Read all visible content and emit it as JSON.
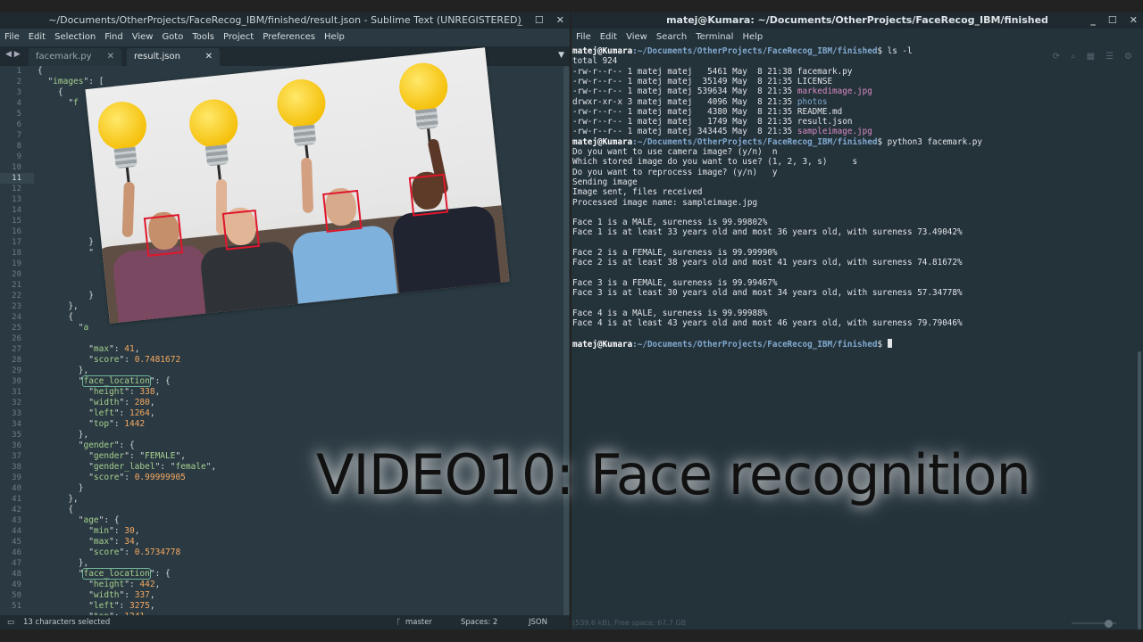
{
  "sublime": {
    "title": "~/Documents/OtherProjects/FaceRecog_IBM/finished/result.json - Sublime Text (UNREGISTERED)",
    "menu": [
      "File",
      "Edit",
      "Selection",
      "Find",
      "View",
      "Goto",
      "Tools",
      "Project",
      "Preferences",
      "Help"
    ],
    "tabs": [
      {
        "label": "facemark.py",
        "active": false
      },
      {
        "label": "result.json",
        "active": true
      }
    ],
    "current_line": 11,
    "line_numbers": [
      1,
      2,
      3,
      4,
      5,
      6,
      7,
      8,
      9,
      10,
      11,
      12,
      13,
      14,
      15,
      16,
      17,
      18,
      19,
      20,
      21,
      22,
      23,
      24,
      25,
      26,
      27,
      28,
      29,
      30,
      31,
      32,
      33,
      34,
      35,
      36,
      37,
      38,
      39,
      40,
      41,
      42,
      43,
      44,
      45,
      46,
      47,
      48,
      49,
      50,
      51
    ],
    "status": {
      "selection": "13 characters selected",
      "branch": "master",
      "spaces": "Spaces: 2",
      "syntax": "JSON"
    }
  },
  "terminal": {
    "title": "matej@Kumara: ~/Documents/OtherProjects/FaceRecog_IBM/finished",
    "menu": [
      "File",
      "Edit",
      "View",
      "Search",
      "Terminal",
      "Help"
    ],
    "prompt_user": "matej@Kumara",
    "prompt_path": ":~/Documents/OtherProjects/FaceRecog_IBM/finished",
    "commands": [
      "ls -l",
      "python3 facemark.py"
    ],
    "ls_total": "total 924",
    "ls_entries": [
      {
        "perms": "-rw-r--r-- 1 matej matej   5461 May  8 21:38 ",
        "name": "facemark.py",
        "color": "plain"
      },
      {
        "perms": "-rw-r--r-- 1 matej matej  35149 May  8 21:35 ",
        "name": "LICENSE",
        "color": "plain"
      },
      {
        "perms": "-rw-r--r-- 1 matej matej 539634 May  8 21:35 ",
        "name": "markedimage.jpg",
        "color": "pink"
      },
      {
        "perms": "drwxr-xr-x 3 matej matej   4096 May  8 21:35 ",
        "name": "photos",
        "color": "blue"
      },
      {
        "perms": "-rw-r--r-- 1 matej matej   4380 May  8 21:35 ",
        "name": "README.md",
        "color": "plain"
      },
      {
        "perms": "-rw-r--r-- 1 matej matej   1749 May  8 21:35 ",
        "name": "result.json",
        "color": "plain"
      },
      {
        "perms": "-rw-r--r-- 1 matej matej 343445 May  8 21:35 ",
        "name": "sampleimage.jpg",
        "color": "pink"
      }
    ],
    "output": [
      "Do you want to use camera image? (y/n)  n",
      "Which stored image do you want to use? (1, 2, 3, s)     s",
      "Do you want to reprocess image? (y/n)   y",
      "Sending image",
      "Image sent, files received",
      "Processed image name: sampleimage.jpg",
      "",
      "Face 1 is a MALE, sureness is 99.99802%",
      "Face 1 is at least 33 years old and most 36 years old, with sureness 73.49042%",
      "",
      "Face 2 is a FEMALE, sureness is 99.99990%",
      "Face 2 is at least 38 years old and most 41 years old, with sureness 74.81672%",
      "",
      "Face 3 is a FEMALE, sureness is 99.99467%",
      "Face 3 is at least 30 years old and most 34 years old, with sureness 57.34778%",
      "",
      "Face 4 is a MALE, sureness is 99.99988%",
      "Face 4 is at least 43 years old and most 46 years old, with sureness 79.79046%"
    ],
    "status_text": "(539.6 kB), Free space: 67.7 GB"
  },
  "caption": "VIDEO10: Face recognition",
  "colors": {
    "editor_bg": "#2b3a42",
    "terminal_bg": "#24323a",
    "json_key": "#a5cf8f",
    "json_number": "#f4a862",
    "face_box": "#e0162b",
    "bulb": "#f5c10c"
  }
}
